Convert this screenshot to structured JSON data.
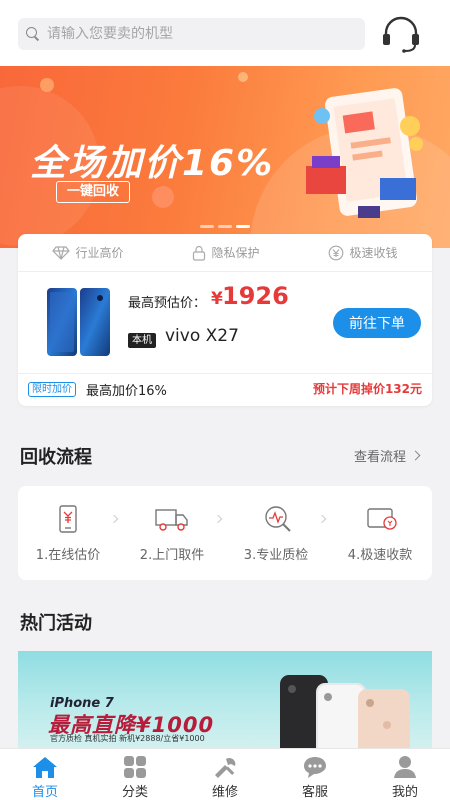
{
  "search": {
    "placeholder": "请输入您要卖的机型"
  },
  "banner": {
    "headline": "全场加价16%",
    "button": "一键回收"
  },
  "card": {
    "features": [
      "行业高价",
      "隐私保护",
      "极速收钱"
    ],
    "estimate_label": "最高预估价：",
    "currency": "¥",
    "estimate_value": "1926",
    "badge": "本机",
    "model": "vivo X27",
    "order_button": "前往下单",
    "limit_tag": "限时加价",
    "limit_text": "最高加价16%",
    "predict": "预计下周掉价132元"
  },
  "process": {
    "title": "回收流程",
    "more": "查看流程",
    "steps": [
      "1.在线估价",
      "2.上门取件",
      "3.专业质检",
      "4.极速收款"
    ]
  },
  "hot": {
    "title": "热门活动",
    "promo_model": "iPhone 7",
    "promo_headline": "最高直降¥1000",
    "promo_sub": "官方质检 真机实拍  新机¥2888/立省¥1000"
  },
  "tabs": [
    {
      "label": "首页",
      "icon": "home-icon",
      "active": true
    },
    {
      "label": "分类",
      "icon": "category-icon",
      "active": false
    },
    {
      "label": "维修",
      "icon": "repair-icon",
      "active": false
    },
    {
      "label": "客服",
      "icon": "chat-icon",
      "active": false
    },
    {
      "label": "我的",
      "icon": "user-icon",
      "active": false
    }
  ],
  "colors": {
    "accent": "#1c8fe8",
    "price": "#e63a3a",
    "banner": "#fb7b3c"
  }
}
